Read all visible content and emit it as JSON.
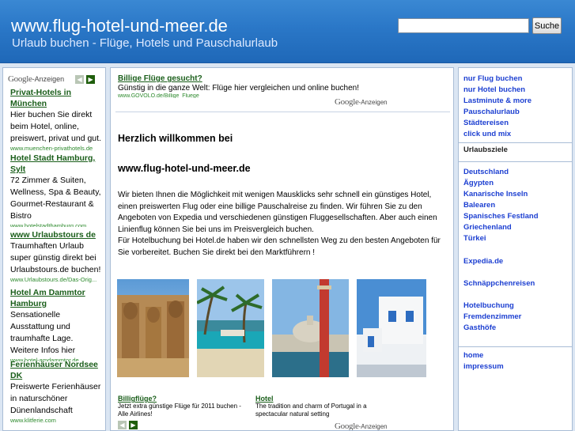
{
  "header": {
    "title": "www.flug-hotel-und-meer.de",
    "subtitle": "Urlaub buchen - Flüge, Hotels und Pauschalurlaub",
    "search_placeholder": "",
    "search_button": "Suche"
  },
  "google": {
    "logo": "Google",
    "anzeigen_left": "-Anzeigen",
    "anzeigen": "-Anzeigen"
  },
  "left_ads": [
    {
      "title": "Privat-Hotels in München",
      "desc": "Hier buchen Sie direkt beim Hotel, online, preiswert, privat und gut.",
      "url": "www.muenchen-privathotels.de"
    },
    {
      "title": "Hotel Stadt Hamburg, Sylt",
      "desc": "72 Zimmer & Suiten, Wellness, Spa & Beauty, Gourmet-Restaurant & Bistro",
      "url": "www.hotelstadthamburg.com"
    },
    {
      "title": "www Urlaubstours de",
      "desc": "Traumhaften Urlaub super günstig direkt bei Urlaubstours.de buchen!",
      "url": "www.Urlaubstours.de/Das-Orig..."
    },
    {
      "title": "Hotel Am Dammtor Hamburg",
      "desc": "Sensationelle Ausstattung und traumhafte Lage. Weitere Infos hier",
      "url": "www.hotel-amdammtor.de"
    },
    {
      "title": "Ferienhäuser Nordsee DK",
      "desc": "Preiswerte Ferienhäuser in naturschöner Dünenlandschaft",
      "url": "www.klitferie.com"
    }
  ],
  "center": {
    "top_ad": {
      "title": "Billige Flüge gesucht?",
      "desc": "Günstig in die ganze Welt: Flüge hier vergleichen und online buchen!",
      "url": "www.GOVOLO.de/Billige_Fluege"
    },
    "welcome_line1": "Herzlich willkommen bei",
    "welcome_line2": "www.flug-hotel-und-meer.de",
    "intro": "Wir bieten Ihnen die Möglichkeit mit wenigen Mausklicks sehr schnell ein günstiges Hotel, einen preiswerten Flug oder eine billige Pauschalreise zu finden. Wir führen Sie zu den Angeboten von Expedia und verschiedenen günstigen Fluggesellschaften. Aber auch einen Linienflug können Sie bei uns im Preisvergleich buchen.",
    "intro2": "Für Hotelbuchung bei Hotel.de haben wir den schnellsten Weg zu den besten Angeboten für Sie vorbereitet. Buchen Sie direkt bei den Marktführern !",
    "bottom_ads": [
      {
        "title": "Billigflüge?",
        "desc": "Jetzt extra günstige Flüge für 2011 buchen - Alle Airlines!"
      },
      {
        "title": "Hotel",
        "desc": "The tradition and charm of Portugal in a spectacular natural setting"
      }
    ]
  },
  "right_menu": {
    "group1": [
      "nur Flug buchen",
      "nur Hotel buchen",
      "Lastminute & more",
      "Pauschalurlaub",
      "Städtereisen",
      "click und mix"
    ],
    "heading": "Urlaubsziele",
    "group2": [
      "Deutschland",
      "Ägypten",
      "Kanarische Inseln",
      "Balearen",
      "Spanisches Festland",
      "Griechenland",
      "Türkei"
    ],
    "expedia": "Expedia.de",
    "deals": "Schnäppchenreisen",
    "group3": [
      "Hotelbuchung",
      "Fremdenzimmer",
      "Gasthöfe"
    ],
    "group4": [
      "home",
      "impressum"
    ]
  },
  "colors": {
    "header_blue": "#2a77c7",
    "ad_green": "#1a5e1a",
    "link_blue": "#1c3fd1"
  }
}
